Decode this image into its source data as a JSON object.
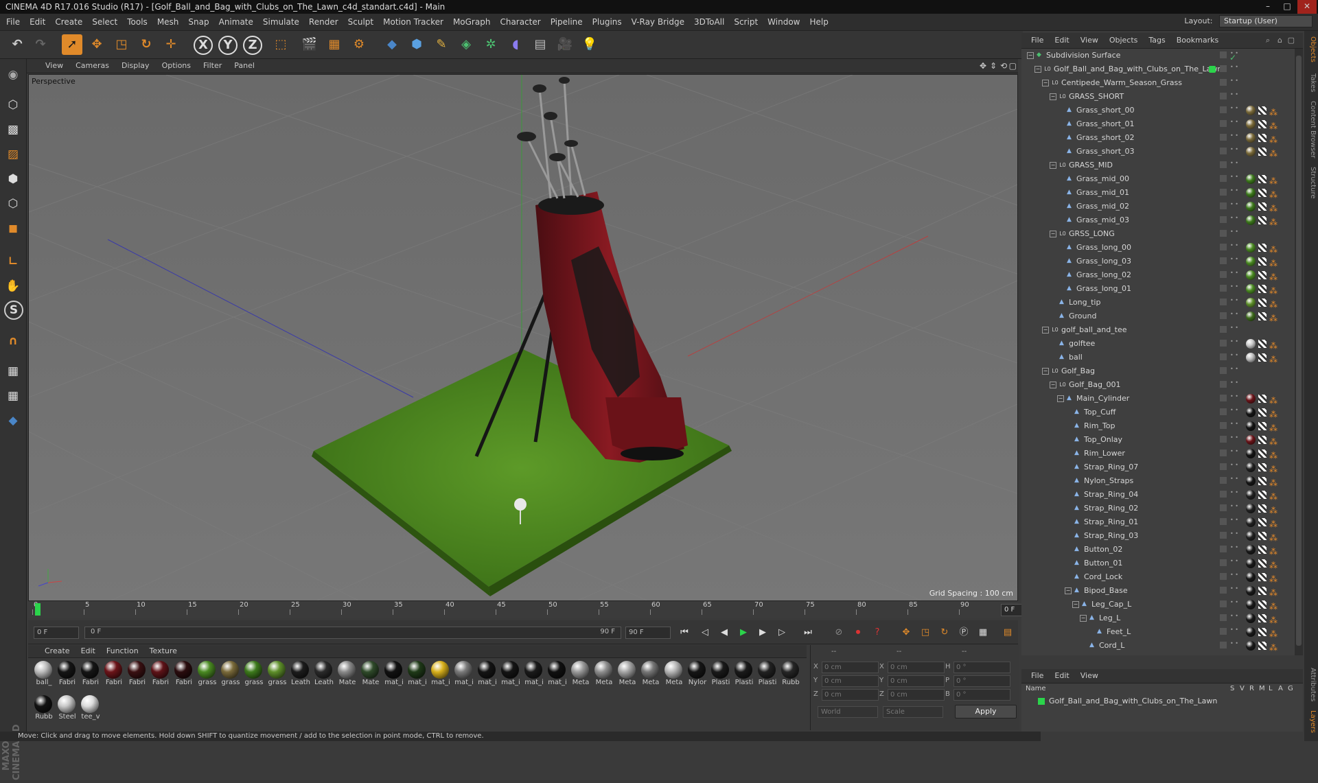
{
  "window": {
    "title": "CINEMA 4D R17.016 Studio (R17) - [Golf_Ball_and_Bag_with_Clubs_on_The_Lawn_c4d_standart.c4d] - Main",
    "controls": [
      "–",
      "□",
      "✕"
    ]
  },
  "menubar": [
    "File",
    "Edit",
    "Create",
    "Select",
    "Tools",
    "Mesh",
    "Snap",
    "Animate",
    "Simulate",
    "Render",
    "Sculpt",
    "Motion Tracker",
    "MoGraph",
    "Character",
    "Pipeline",
    "Plugins",
    "V-Ray Bridge",
    "3DToAll",
    "Script",
    "Window",
    "Help"
  ],
  "layout": {
    "label": "Layout:",
    "value": "Startup (User)"
  },
  "toolbar": {
    "icons": [
      "undo-icon",
      "redo-icon",
      "select-icon",
      "move-icon",
      "scale-icon",
      "rotate-icon",
      "transform-icon",
      "x-axis-icon",
      "y-axis-icon",
      "z-axis-icon",
      "coordinate-system-icon",
      "render-view-icon",
      "render-picture-viewer-icon",
      "render-settings-icon",
      "python-icon",
      "cube-icon",
      "pen-icon",
      "subdivision-icon",
      "mograph-cloner-icon",
      "deformer-icon",
      "floor-icon",
      "camera-icon",
      "light-icon"
    ],
    "axis_labels": [
      "X",
      "Y",
      "Z"
    ]
  },
  "viewport": {
    "menu": [
      "View",
      "Cameras",
      "Display",
      "Options",
      "Filter",
      "Panel"
    ],
    "label": "Perspective",
    "grid_spacing": "Grid Spacing : 100 cm"
  },
  "timeline": {
    "ticks": [
      "0",
      "5",
      "10",
      "15",
      "20",
      "25",
      "30",
      "35",
      "40",
      "45",
      "50",
      "55",
      "60",
      "65",
      "70",
      "75",
      "80",
      "85",
      "90"
    ],
    "current_frame": "0 F",
    "start_field": "0 F",
    "range_start": "0 F",
    "range_end": "90 F",
    "end_field": "90 F"
  },
  "material_menu": [
    "Create",
    "Edit",
    "Function",
    "Texture"
  ],
  "materials": [
    {
      "label": "ball_",
      "color": "#bdbdbd"
    },
    {
      "label": "Fabri",
      "color": "#151515"
    },
    {
      "label": "Fabri",
      "color": "#151515"
    },
    {
      "label": "Fabri",
      "color": "#6b1419"
    },
    {
      "label": "Fabri",
      "color": "#3a1012"
    },
    {
      "label": "Fabri",
      "color": "#5e1318"
    },
    {
      "label": "Fabri",
      "color": "#2a0c0e"
    },
    {
      "label": "grass",
      "color": "#4a8a22"
    },
    {
      "label": "grass",
      "color": "#7a6a3a"
    },
    {
      "label": "grass",
      "color": "#3d7a1c"
    },
    {
      "label": "grass",
      "color": "#5e8f2a"
    },
    {
      "label": "Leath",
      "color": "#1c1c1c"
    },
    {
      "label": "Leath",
      "color": "#2a2a2a"
    },
    {
      "label": "Mate",
      "color": "#8a8a8a"
    },
    {
      "label": "Mate",
      "color": "#2f4a2a"
    },
    {
      "label": "mat_i",
      "color": "#111111"
    },
    {
      "label": "mat_i",
      "color": "#1f3a18"
    },
    {
      "label": "mat_i",
      "color": "#d8b01c"
    },
    {
      "label": "mat_i",
      "color": "#7a7a7a"
    },
    {
      "label": "mat_i",
      "color": "#141414"
    },
    {
      "label": "mat_i",
      "color": "#141414"
    },
    {
      "label": "mat_i",
      "color": "#1a1a1a"
    },
    {
      "label": "mat_i",
      "color": "#101010"
    },
    {
      "label": "Meta",
      "color": "#9a9a9a"
    },
    {
      "label": "Meta",
      "color": "#8f8f8f"
    },
    {
      "label": "Meta",
      "color": "#a5a5a5"
    },
    {
      "label": "Meta",
      "color": "#777777"
    },
    {
      "label": "Meta",
      "color": "#b5b5b5"
    },
    {
      "label": "Nylor",
      "color": "#161616"
    },
    {
      "label": "Plasti",
      "color": "#1a1a1a"
    },
    {
      "label": "Plasti",
      "color": "#1a1a1a"
    },
    {
      "label": "Plasti",
      "color": "#222222"
    },
    {
      "label": "Rubb",
      "color": "#262626"
    },
    {
      "label": "Rubb",
      "color": "#121212"
    },
    {
      "label": "Steel",
      "color": "#c8c8c8"
    },
    {
      "label": "tee_v",
      "color": "#dcdcdc"
    }
  ],
  "coords": {
    "header": [
      "--",
      "--",
      "--"
    ],
    "rows": [
      {
        "a": "X",
        "av": "0 cm",
        "b": "X",
        "bv": "0 cm",
        "c": "H",
        "cv": "0 °"
      },
      {
        "a": "Y",
        "av": "0 cm",
        "b": "Y",
        "bv": "0 cm",
        "c": "P",
        "cv": "0 °"
      },
      {
        "a": "Z",
        "av": "0 cm",
        "b": "Z",
        "bv": "0 cm",
        "c": "B",
        "cv": "0 °"
      }
    ],
    "mode": "World",
    "scale_mode": "Scale",
    "apply": "Apply"
  },
  "status": "Move: Click and drag to move elements. Hold down SHIFT to quantize movement / add to the selection in point mode, CTRL to remove.",
  "object_manager": {
    "menu": [
      "File",
      "Edit",
      "View",
      "Objects",
      "Tags",
      "Bookmarks"
    ],
    "rows": [
      {
        "name": "Subdivision Surface",
        "depth": 0,
        "type": "subdiv",
        "tag": "none",
        "check": true
      },
      {
        "name": "Golf_Ball_and_Bag_with_Clubs_on_The_Lawn",
        "depth": 1,
        "type": "null",
        "tag": "layer"
      },
      {
        "name": "Centipede_Warm_Season_Grass",
        "depth": 2,
        "type": "null",
        "tag": "none"
      },
      {
        "name": "GRASS_SHORT",
        "depth": 3,
        "type": "null",
        "tag": "none"
      },
      {
        "name": "Grass_short_00",
        "depth": 4,
        "type": "obj",
        "tag": "#7a6a3a"
      },
      {
        "name": "Grass_short_01",
        "depth": 4,
        "type": "obj",
        "tag": "#7a6a3a"
      },
      {
        "name": "Grass_short_02",
        "depth": 4,
        "type": "obj",
        "tag": "#7a6a3a"
      },
      {
        "name": "Grass_short_03",
        "depth": 4,
        "type": "obj",
        "tag": "#7a6a3a"
      },
      {
        "name": "GRASS_MID",
        "depth": 3,
        "type": "null",
        "tag": "none"
      },
      {
        "name": "Grass_mid_00",
        "depth": 4,
        "type": "obj",
        "tag": "#3d7a1c"
      },
      {
        "name": "Grass_mid_01",
        "depth": 4,
        "type": "obj",
        "tag": "#3d7a1c"
      },
      {
        "name": "Grass_mid_02",
        "depth": 4,
        "type": "obj",
        "tag": "#3d7a1c"
      },
      {
        "name": "Grass_mid_03",
        "depth": 4,
        "type": "obj",
        "tag": "#3d7a1c"
      },
      {
        "name": "GRSS_LONG",
        "depth": 3,
        "type": "null",
        "tag": "none"
      },
      {
        "name": "Grass_long_00",
        "depth": 4,
        "type": "obj",
        "tag": "#4a8a22"
      },
      {
        "name": "Grass_long_03",
        "depth": 4,
        "type": "obj",
        "tag": "#4a8a22"
      },
      {
        "name": "Grass_long_02",
        "depth": 4,
        "type": "obj",
        "tag": "#4a8a22"
      },
      {
        "name": "Grass_long_01",
        "depth": 4,
        "type": "obj",
        "tag": "#4a8a22"
      },
      {
        "name": "Long_tip",
        "depth": 3,
        "type": "obj",
        "tag": "#5e8f2a"
      },
      {
        "name": "Ground",
        "depth": 3,
        "type": "obj",
        "tag": "#3d6a1c"
      },
      {
        "name": "golf_ball_and_tee",
        "depth": 2,
        "type": "null",
        "tag": "none"
      },
      {
        "name": "golftee",
        "depth": 3,
        "type": "obj",
        "tag": "#c8c8c8"
      },
      {
        "name": "ball",
        "depth": 3,
        "type": "obj",
        "tag": "#bdbdbd"
      },
      {
        "name": "Golf_Bag",
        "depth": 2,
        "type": "null",
        "tag": "none"
      },
      {
        "name": "Golf_Bag_001",
        "depth": 3,
        "type": "null",
        "tag": "none"
      },
      {
        "name": "Main_Cylinder",
        "depth": 4,
        "type": "obj",
        "tag": "#6b1419"
      },
      {
        "name": "Top_Cuff",
        "depth": 5,
        "type": "obj",
        "tag": "#151515"
      },
      {
        "name": "Rim_Top",
        "depth": 5,
        "type": "obj",
        "tag": "#151515"
      },
      {
        "name": "Top_Onlay",
        "depth": 5,
        "type": "obj",
        "tag": "#6b1419"
      },
      {
        "name": "Rim_Lower",
        "depth": 5,
        "type": "obj",
        "tag": "#151515"
      },
      {
        "name": "Strap_Ring_07",
        "depth": 5,
        "type": "obj",
        "tag": "#222222"
      },
      {
        "name": "Nylon_Straps",
        "depth": 5,
        "type": "obj",
        "tag": "#161616"
      },
      {
        "name": "Strap_Ring_04",
        "depth": 5,
        "type": "obj",
        "tag": "#222222"
      },
      {
        "name": "Strap_Ring_02",
        "depth": 5,
        "type": "obj",
        "tag": "#222222"
      },
      {
        "name": "Strap_Ring_01",
        "depth": 5,
        "type": "obj",
        "tag": "#222222"
      },
      {
        "name": "Strap_Ring_03",
        "depth": 5,
        "type": "obj",
        "tag": "#222222"
      },
      {
        "name": "Button_02",
        "depth": 5,
        "type": "obj",
        "tag": "#1a1a1a"
      },
      {
        "name": "Button_01",
        "depth": 5,
        "type": "obj",
        "tag": "#1a1a1a"
      },
      {
        "name": "Cord_Lock",
        "depth": 5,
        "type": "obj",
        "tag": "#1a1a1a"
      },
      {
        "name": "Bipod_Base",
        "depth": 5,
        "type": "obj",
        "tag": "#1a1a1a"
      },
      {
        "name": "Leg_Cap_L",
        "depth": 6,
        "type": "obj",
        "tag": "#1a1a1a"
      },
      {
        "name": "Leg_L",
        "depth": 7,
        "type": "obj",
        "tag": "#1a1a1a"
      },
      {
        "name": "Feet_L",
        "depth": 8,
        "type": "obj",
        "tag": "#1a1a1a"
      },
      {
        "name": "Cord_L",
        "depth": 7,
        "type": "obj",
        "tag": "#1a1a1a"
      }
    ]
  },
  "right_tabs": [
    "Objects",
    "Takes",
    "Content Browser",
    "Structure"
  ],
  "right_tabs_bottom": [
    "Attributes",
    "Layers"
  ],
  "layers": {
    "menu": [
      "File",
      "Edit",
      "View"
    ],
    "columns": [
      "Name",
      "S",
      "V",
      "R",
      "M",
      "L",
      "A",
      "G"
    ],
    "row": "Golf_Ball_and_Bag_with_Clubs_on_The_Lawn"
  }
}
